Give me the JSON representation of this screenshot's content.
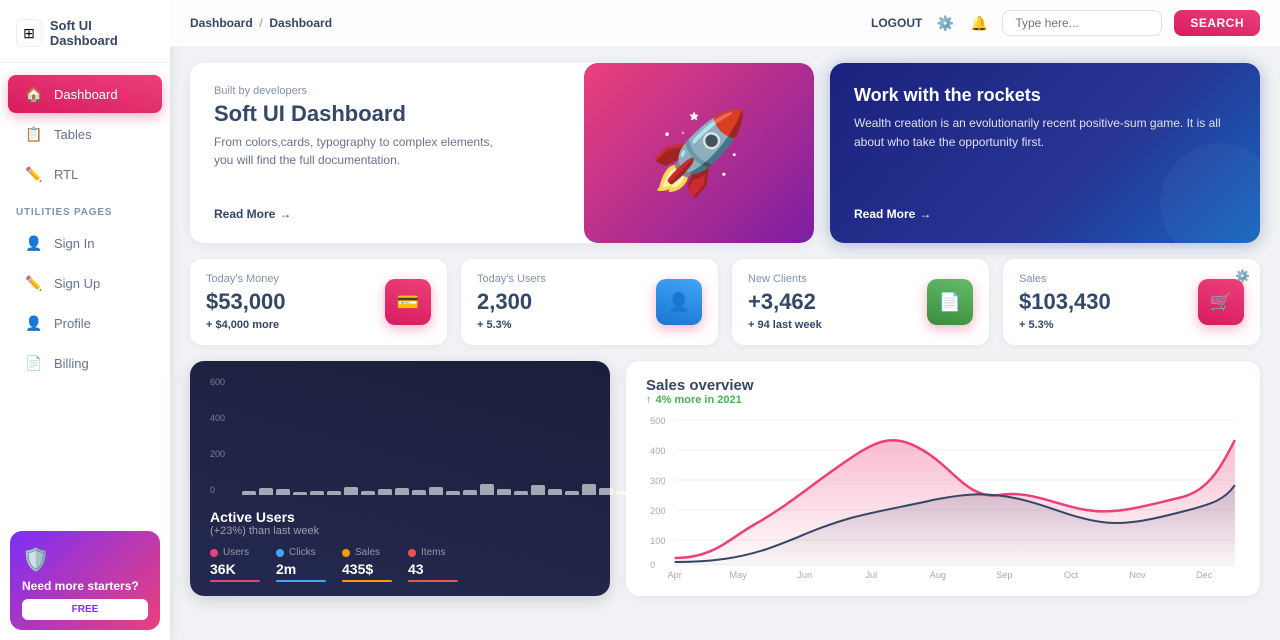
{
  "sidebar": {
    "logo_text": "Soft UI Dashboard",
    "logo_icon": "⬜",
    "nav_items": [
      {
        "id": "dashboard",
        "label": "Dashboard",
        "icon": "🏠",
        "active": true
      },
      {
        "id": "tables",
        "label": "Tables",
        "icon": "📋",
        "active": false
      },
      {
        "id": "rtl",
        "label": "RTL",
        "icon": "✏️",
        "active": false
      }
    ],
    "utilities_label": "UTILITIES PAGES",
    "utilities_items": [
      {
        "id": "signin",
        "label": "Sign In",
        "icon": "👤"
      },
      {
        "id": "signup",
        "label": "Sign Up",
        "icon": "✏️"
      },
      {
        "id": "profile",
        "label": "Profile",
        "icon": "👤"
      },
      {
        "id": "billing",
        "label": "Billing",
        "icon": "📄"
      }
    ],
    "promo_icon": "🛡️",
    "promo_title": "Need more starters?",
    "promo_btn": "FREE"
  },
  "header": {
    "breadcrumb_root": "Dashboard",
    "breadcrumb_current": "Dashboard",
    "logout_label": "LOGOUT",
    "search_placeholder": "Type here...",
    "search_btn": "SEARCH"
  },
  "hero": {
    "subtitle": "Built by developers",
    "title": "Soft UI Dashboard",
    "description": "From colors,cards, typography to complex elements, you will find the full documentation.",
    "read_more": "Read More",
    "dark_title": "Work with the rockets",
    "dark_description": "Wealth creation is an evolutionarily recent positive-sum game. It is all about who take the opportunity first.",
    "dark_read_more": "Read More"
  },
  "stats": [
    {
      "label": "Today's Money",
      "value": "$53,000",
      "change": "+ $4,000",
      "change_text": " more",
      "icon": "💳"
    },
    {
      "label": "Today's Users",
      "value": "2,300",
      "change": "+ 5.3%",
      "change_text": "",
      "icon": "👤"
    },
    {
      "label": "New Clients",
      "value": "+3,462",
      "change": "+ 94",
      "change_text": " last week",
      "icon": "📄"
    },
    {
      "label": "Sales",
      "value": "$103,430",
      "change": "+ 5.3%",
      "change_text": "",
      "icon": "🛒"
    }
  ],
  "bar_chart": {
    "y_labels": [
      "600",
      "400",
      "200",
      "0"
    ],
    "bars": [
      18,
      35,
      28,
      15,
      22,
      18,
      42,
      20,
      28,
      35,
      25,
      38,
      18,
      25,
      55,
      30,
      20,
      48,
      28,
      22,
      55,
      35,
      18,
      60
    ],
    "title": "Active Users",
    "subtitle": "(+23%) than last week",
    "legend": [
      {
        "color": "#ec407a",
        "label": "Users",
        "value": "36K",
        "bar_color": "#ec407a"
      },
      {
        "color": "#42a5f5",
        "label": "Clicks",
        "value": "2m",
        "bar_color": "#42a5f5"
      },
      {
        "color": "#ff9800",
        "label": "Sales",
        "value": "435$",
        "bar_color": "#ff9800"
      },
      {
        "color": "#ef5350",
        "label": "Items",
        "value": "43",
        "bar_color": "#ef5350"
      }
    ]
  },
  "line_chart": {
    "title": "Sales overview",
    "subtitle": "4% more in 2021",
    "x_labels": [
      "Apr",
      "May",
      "Jun",
      "Jul",
      "Aug",
      "Sep",
      "Oct",
      "Nov",
      "Dec"
    ],
    "y_labels": [
      "500",
      "400",
      "300",
      "200",
      "100",
      "0"
    ]
  },
  "colors": {
    "accent": "#ec407a",
    "accent_dark": "#d81b60",
    "sidebar_active_bg": "linear-gradient(195deg, #ec407a, #d81b60)",
    "positive": "#4caf50"
  }
}
